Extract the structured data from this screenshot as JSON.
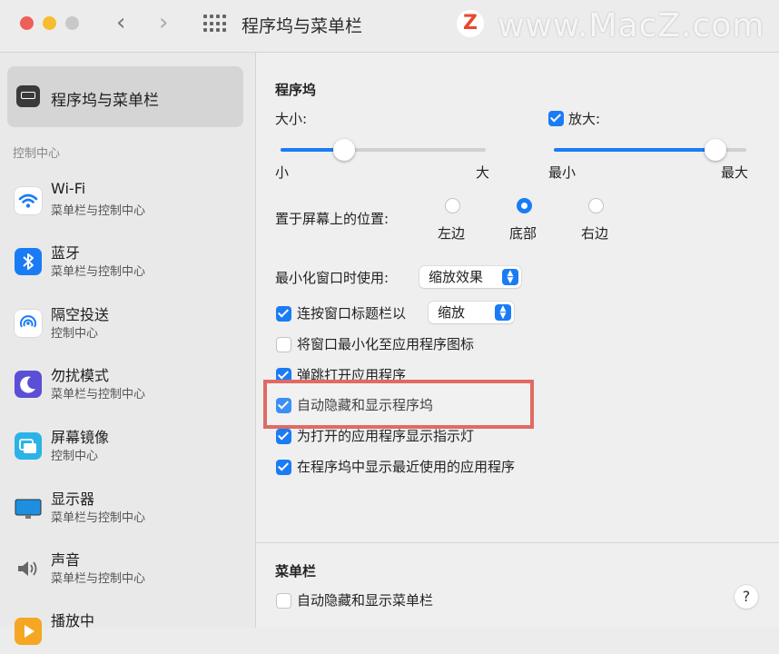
{
  "window": {
    "title": "程序坞与菜单栏",
    "back_glyph": "‹",
    "forward_glyph": "›",
    "watermark_logo": "Z",
    "watermark_text": "www.MacZ.com"
  },
  "colors": {
    "accent": "#1a7cf5",
    "highlight_box": "#e06a63"
  },
  "sidebar": {
    "selected": {
      "label": "程序坞与菜单栏",
      "icon": "dock-icon"
    },
    "section_label": "控制中心",
    "items": [
      {
        "title": "Wi-Fi",
        "subtitle": "菜单栏与控制中心",
        "icon": "wifi-icon"
      },
      {
        "title": "蓝牙",
        "subtitle": "菜单栏与控制中心",
        "icon": "bluetooth-icon"
      },
      {
        "title": "隔空投送",
        "subtitle": "控制中心",
        "icon": "airdrop-icon"
      },
      {
        "title": "勿扰模式",
        "subtitle": "菜单栏与控制中心",
        "icon": "moon-icon"
      },
      {
        "title": "屏幕镜像",
        "subtitle": "控制中心",
        "icon": "screen-mirror-icon"
      },
      {
        "title": "显示器",
        "subtitle": "菜单栏与控制中心",
        "icon": "display-icon"
      },
      {
        "title": "声音",
        "subtitle": "菜单栏与控制中心",
        "icon": "speaker-icon"
      },
      {
        "title": "播放中",
        "subtitle": "",
        "icon": "now-playing-icon"
      }
    ]
  },
  "dock": {
    "section_title": "程序坞",
    "size": {
      "label": "大小:",
      "min": "小",
      "max": "大",
      "value": 0.3
    },
    "magnification": {
      "label": "放大:",
      "checked": true,
      "min": "最小",
      "max": "最大",
      "value": 0.85
    },
    "position": {
      "label": "置于屏幕上的位置:",
      "options": [
        {
          "label": "左边",
          "selected": false
        },
        {
          "label": "底部",
          "selected": true
        },
        {
          "label": "右边",
          "selected": false
        }
      ]
    },
    "minimize_effect": {
      "label": "最小化窗口时使用:",
      "value": "缩放效果"
    },
    "double_click": {
      "label": "连按窗口标题栏以",
      "checked": true,
      "value": "缩放"
    },
    "checkboxes": [
      {
        "label": "将窗口最小化至应用程序图标",
        "checked": false
      },
      {
        "label": "弹跳打开应用程序",
        "checked": true
      },
      {
        "label": "自动隐藏和显示程序坞",
        "checked": true
      },
      {
        "label": "为打开的应用程序显示指示灯",
        "checked": true
      },
      {
        "label": "在程序坞中显示最近使用的应用程序",
        "checked": true
      }
    ]
  },
  "menubar": {
    "section_title": "菜单栏",
    "autohide": {
      "label": "自动隐藏和显示菜单栏",
      "checked": false
    }
  },
  "help": {
    "label": "?"
  }
}
